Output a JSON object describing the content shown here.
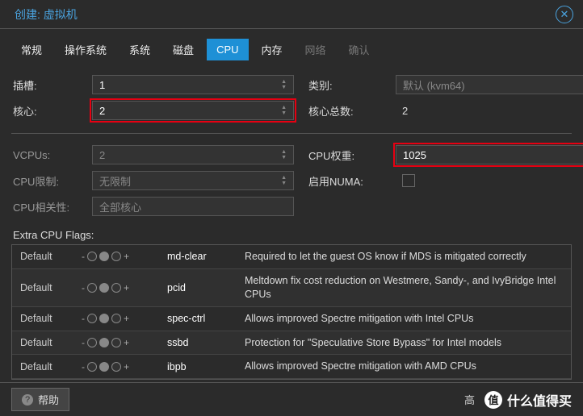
{
  "title": "创建: 虚拟机",
  "tabs": [
    {
      "label": "常规"
    },
    {
      "label": "操作系统"
    },
    {
      "label": "系统"
    },
    {
      "label": "磁盘"
    },
    {
      "label": "CPU",
      "active": true
    },
    {
      "label": "内存"
    },
    {
      "label": "网络",
      "disabled": true
    },
    {
      "label": "确认",
      "disabled": true
    }
  ],
  "form": {
    "slots_label": "插槽:",
    "slots_value": "1",
    "type_label": "类别:",
    "type_value": "默认 (kvm64)",
    "cores_label": "核心:",
    "cores_value": "2",
    "total_cores_label": "核心总数:",
    "total_cores_value": "2",
    "vcpus_label": "VCPUs:",
    "vcpus_value": "2",
    "weight_label": "CPU权重:",
    "weight_value": "1025",
    "limit_label": "CPU限制:",
    "limit_value": "无限制",
    "numa_label": "启用NUMA:",
    "affinity_label": "CPU相关性:",
    "affinity_value": "全部核心"
  },
  "flags": {
    "header": "Extra CPU Flags:",
    "default_label": "Default",
    "rows": [
      {
        "name": "md-clear",
        "desc": "Required to let the guest OS know if MDS is mitigated correctly"
      },
      {
        "name": "pcid",
        "desc": "Meltdown fix cost reduction on Westmere, Sandy-, and IvyBridge Intel CPUs"
      },
      {
        "name": "spec-ctrl",
        "desc": "Allows improved Spectre mitigation with Intel CPUs"
      },
      {
        "name": "ssbd",
        "desc": "Protection for \"Speculative Store Bypass\" for Intel models"
      },
      {
        "name": "ibpb",
        "desc": "Allows improved Spectre mitigation with AMD CPUs"
      }
    ]
  },
  "footer": {
    "help": "帮助",
    "advanced_prefix": "高",
    "watermark": "什么值得买"
  }
}
